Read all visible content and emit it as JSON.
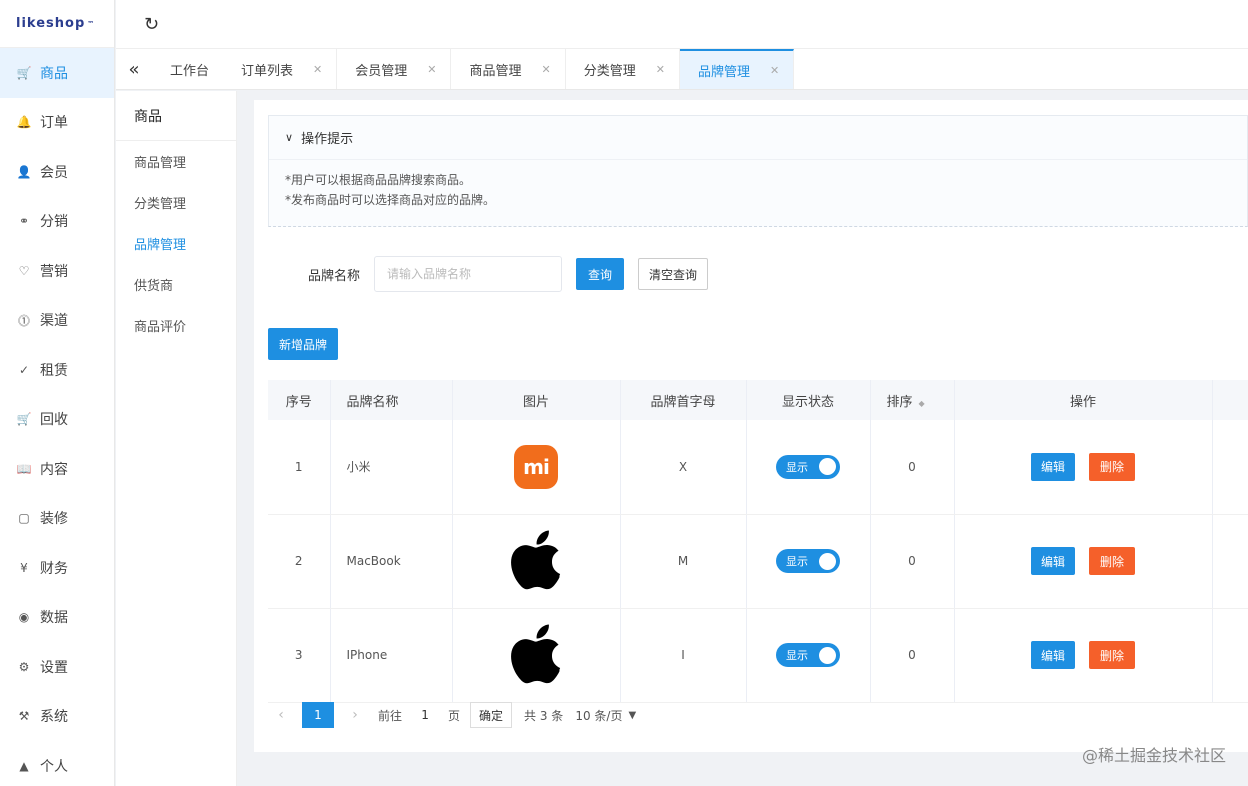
{
  "app": {
    "logo": "likeshop"
  },
  "sidebar": {
    "items": [
      {
        "icon": "cart-icon",
        "glyph": "🛒",
        "label": "商品",
        "active": true
      },
      {
        "icon": "bell-icon",
        "glyph": "🔔",
        "label": "订单"
      },
      {
        "icon": "user-icon",
        "glyph": "👤",
        "label": "会员"
      },
      {
        "icon": "share-icon",
        "glyph": "⚭",
        "label": "分销"
      },
      {
        "icon": "heart-icon",
        "glyph": "♡",
        "label": "营销"
      },
      {
        "icon": "channel-icon",
        "glyph": "⓵",
        "label": "渠道"
      },
      {
        "icon": "check-circle-icon",
        "glyph": "✓",
        "label": "租赁"
      },
      {
        "icon": "recycle-cart-icon",
        "glyph": "🛒",
        "label": "回收"
      },
      {
        "icon": "book-icon",
        "glyph": "📖",
        "label": "内容"
      },
      {
        "icon": "decor-icon",
        "glyph": "▢",
        "label": "装修"
      },
      {
        "icon": "finance-icon",
        "glyph": "¥",
        "label": "财务"
      },
      {
        "icon": "data-icon",
        "glyph": "◉",
        "label": "数据"
      },
      {
        "icon": "settings-icon",
        "glyph": "⚙",
        "label": "设置"
      },
      {
        "icon": "system-icon",
        "glyph": "⚒",
        "label": "系统"
      },
      {
        "icon": "person-icon",
        "glyph": "▲",
        "label": "个人"
      }
    ]
  },
  "topbar": {
    "refresh_icon": "↻"
  },
  "tabs": {
    "collapse_icon": "«",
    "items": [
      {
        "label": "工作台",
        "closable": false
      },
      {
        "label": "订单列表",
        "closable": true
      },
      {
        "label": "会员管理",
        "closable": true
      },
      {
        "label": "商品管理",
        "closable": true
      },
      {
        "label": "分类管理",
        "closable": true
      },
      {
        "label": "品牌管理",
        "closable": true,
        "active": true
      }
    ]
  },
  "submenu": {
    "title": "商品",
    "items": [
      {
        "label": "商品管理"
      },
      {
        "label": "分类管理"
      },
      {
        "label": "品牌管理",
        "active": true
      },
      {
        "label": "供货商"
      },
      {
        "label": "商品评价"
      }
    ]
  },
  "tips": {
    "title": "操作提示",
    "lines": [
      "*用户可以根据商品品牌搜索商品。",
      "*发布商品时可以选择商品对应的品牌。"
    ]
  },
  "search": {
    "label": "品牌名称",
    "placeholder": "请输入品牌名称",
    "query_label": "查询",
    "reset_label": "清空查询"
  },
  "add_button": {
    "label": "新增品牌"
  },
  "table": {
    "columns": [
      "序号",
      "品牌名称",
      "图片",
      "品牌首字母",
      "显示状态",
      "排序",
      "操作"
    ],
    "rows": [
      {
        "index": "1",
        "name": "小米",
        "logo": "mi",
        "initial": "X",
        "status": "显示",
        "sort": "0"
      },
      {
        "index": "2",
        "name": "MacBook",
        "logo": "apple",
        "initial": "M",
        "status": "显示",
        "sort": "0"
      },
      {
        "index": "3",
        "name": "IPhone",
        "logo": "apple",
        "initial": "I",
        "status": "显示",
        "sort": "0"
      }
    ],
    "edit_label": "编辑",
    "delete_label": "删除"
  },
  "pagination": {
    "current_page": "1",
    "goto_prefix": "前往",
    "goto_value": "1",
    "goto_suffix": "页",
    "confirm_label": "确定",
    "total": "共 3 条",
    "page_size": "10 条/页"
  },
  "watermark": "@稀土掘金技术社区",
  "colors": {
    "primary": "#1e8fe1",
    "danger": "#f5602a",
    "mi_orange": "#f16d1c"
  }
}
